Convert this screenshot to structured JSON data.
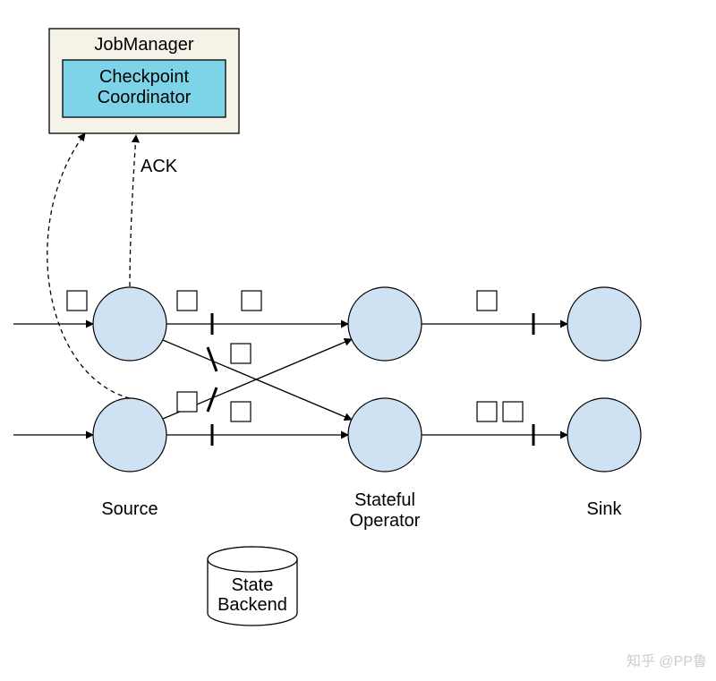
{
  "jobmanager": {
    "title": "JobManager",
    "coordinator": "Checkpoint\nCoordinator"
  },
  "ack_label": "ACK",
  "columns": {
    "source": "Source",
    "stateful": "Stateful\nOperator",
    "sink": "Sink"
  },
  "state_backend": "State\nBackend",
  "watermark": "知乎 @PP鲁"
}
